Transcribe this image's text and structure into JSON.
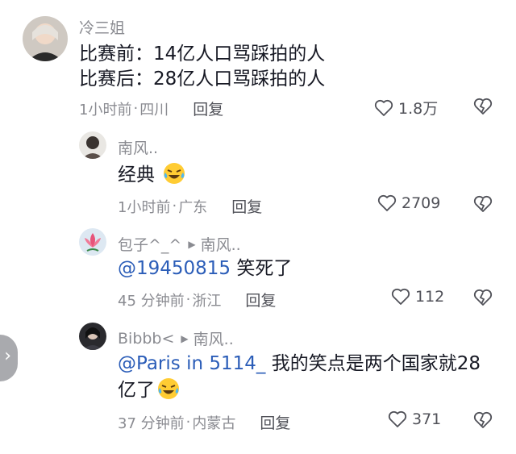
{
  "comments": [
    {
      "username": "冷三姐",
      "text_lines": [
        "比赛前：14亿人口骂踩拍的人",
        "比赛后：28亿人口骂踩拍的人"
      ],
      "time": "1小时前",
      "location": "四川",
      "reply_label": "回复",
      "likes": "1.8万"
    },
    {
      "username": "南风..",
      "text": "经典",
      "emoji": "laughing-crying-emoji",
      "time": "1小时前",
      "location": "广东",
      "reply_label": "回复",
      "likes": "2709"
    },
    {
      "username": "包子^_^",
      "reply_to": "南风..",
      "mention": "@19450815",
      "text": " 笑死了",
      "time": "45 分钟前",
      "location": "浙江",
      "reply_label": "回复",
      "likes": "112"
    },
    {
      "username": "Bibbb<",
      "reply_to": "南风..",
      "mention": "@Paris in 5114_",
      "text_line1": " 我的笑点是两个国家就28",
      "text_line2": "亿了",
      "emoji": "laughing-crying-emoji",
      "time": "37 分钟前",
      "location": "内蒙古",
      "reply_label": "回复",
      "likes": "371"
    }
  ],
  "separator": "·",
  "colors": {
    "mention": "#2b5db8",
    "meta": "#8a8b91",
    "text": "#161823"
  }
}
